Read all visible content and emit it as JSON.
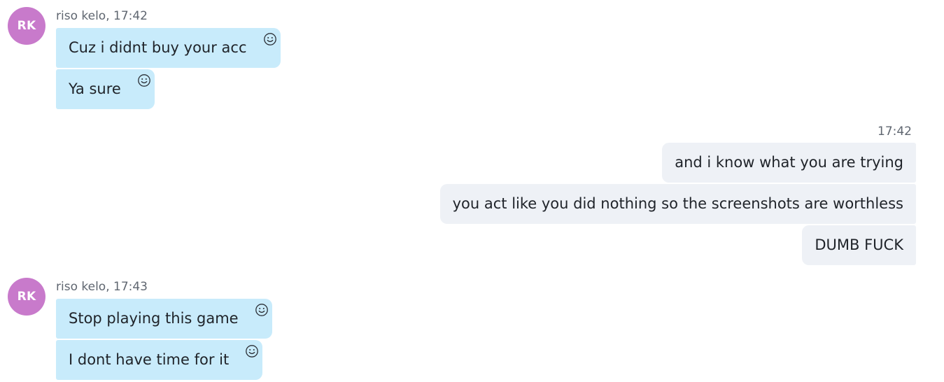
{
  "colors": {
    "avatar_bg": "#c87acb",
    "incoming_bubble": "#c8ebfb",
    "outgoing_bubble": "#eef1f6",
    "meta_text": "#5f6670"
  },
  "groups": [
    {
      "avatar": {
        "initials": "RK",
        "icon": "avatar"
      },
      "header": "riso kelo, 17:42",
      "messages": [
        {
          "text": "Cuz i didnt buy your acc",
          "reaction_icon": "smiley-icon"
        },
        {
          "text": "Ya sure",
          "reaction_icon": "smiley-icon"
        }
      ]
    },
    {
      "header": "17:42",
      "messages": [
        {
          "text": "and i know what you are trying"
        },
        {
          "text": "you act like you did nothing so the screenshots are worthless"
        },
        {
          "text": "DUMB FUCK"
        }
      ]
    },
    {
      "avatar": {
        "initials": "RK",
        "icon": "avatar"
      },
      "header": "riso kelo, 17:43",
      "messages": [
        {
          "text": "Stop playing this game",
          "reaction_icon": "smiley-icon"
        },
        {
          "text": "I dont have time for it",
          "reaction_icon": "smiley-icon"
        }
      ]
    }
  ]
}
